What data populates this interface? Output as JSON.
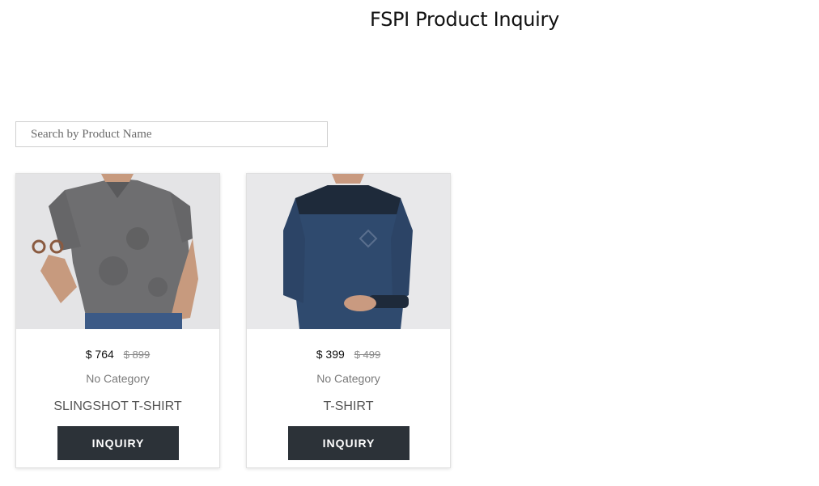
{
  "page": {
    "title": "FSPI Product Inquiry"
  },
  "search": {
    "placeholder": "Search by Product Name",
    "value": ""
  },
  "products": [
    {
      "image": "grey-polo-shirt-photo",
      "price": "$ 764",
      "original_price": "$ 899",
      "category": "No Category",
      "name": "SLINGSHOT T-SHIRT",
      "button_label": "INQUIRY"
    },
    {
      "image": "navy-long-sleeve-shirt-photo",
      "price": "$ 399",
      "original_price": "$ 499",
      "category": "No Category",
      "name": "T-SHIRT",
      "button_label": "INQUIRY"
    }
  ],
  "colors": {
    "button_bg": "#2c3238",
    "button_text": "#ffffff",
    "card_border": "#e0e0e0",
    "image_bg": "#e6e6e8"
  }
}
